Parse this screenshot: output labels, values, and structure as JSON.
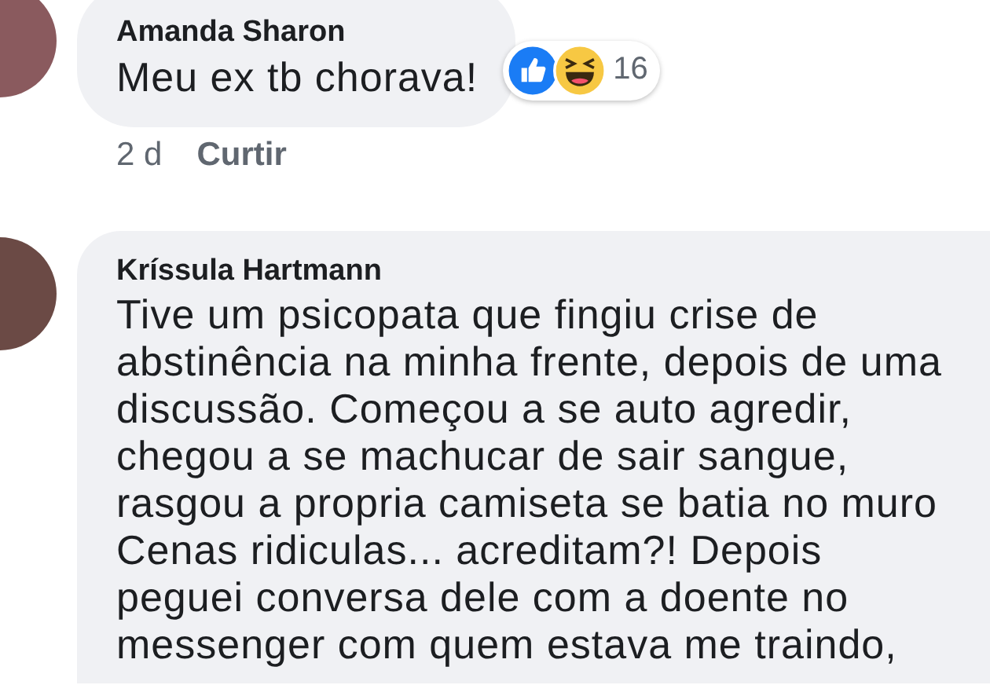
{
  "comments": [
    {
      "author": "Amanda Sharon",
      "lines": [
        "Meu ex tb chorava!"
      ],
      "reactions": {
        "icons": [
          {
            "kind": "like"
          },
          {
            "kind": "haha"
          }
        ],
        "count": "16"
      },
      "time": "2 d",
      "like_label": "Curtir"
    },
    {
      "author": "Kríssula Hartmann",
      "lines": [
        "Tive um psicopata que fingiu crise de",
        "abstinência na minha frente, depois de uma",
        "discussão. Começou a  se auto agredir,",
        "chegou a se machucar de sair sangue,",
        "rasgou a propria camiseta se batia no muro",
        "Cenas ridiculas... acreditam?!  Depois",
        "peguei conversa dele com a doente no",
        "messenger com quem estava me traindo,"
      ]
    }
  ]
}
